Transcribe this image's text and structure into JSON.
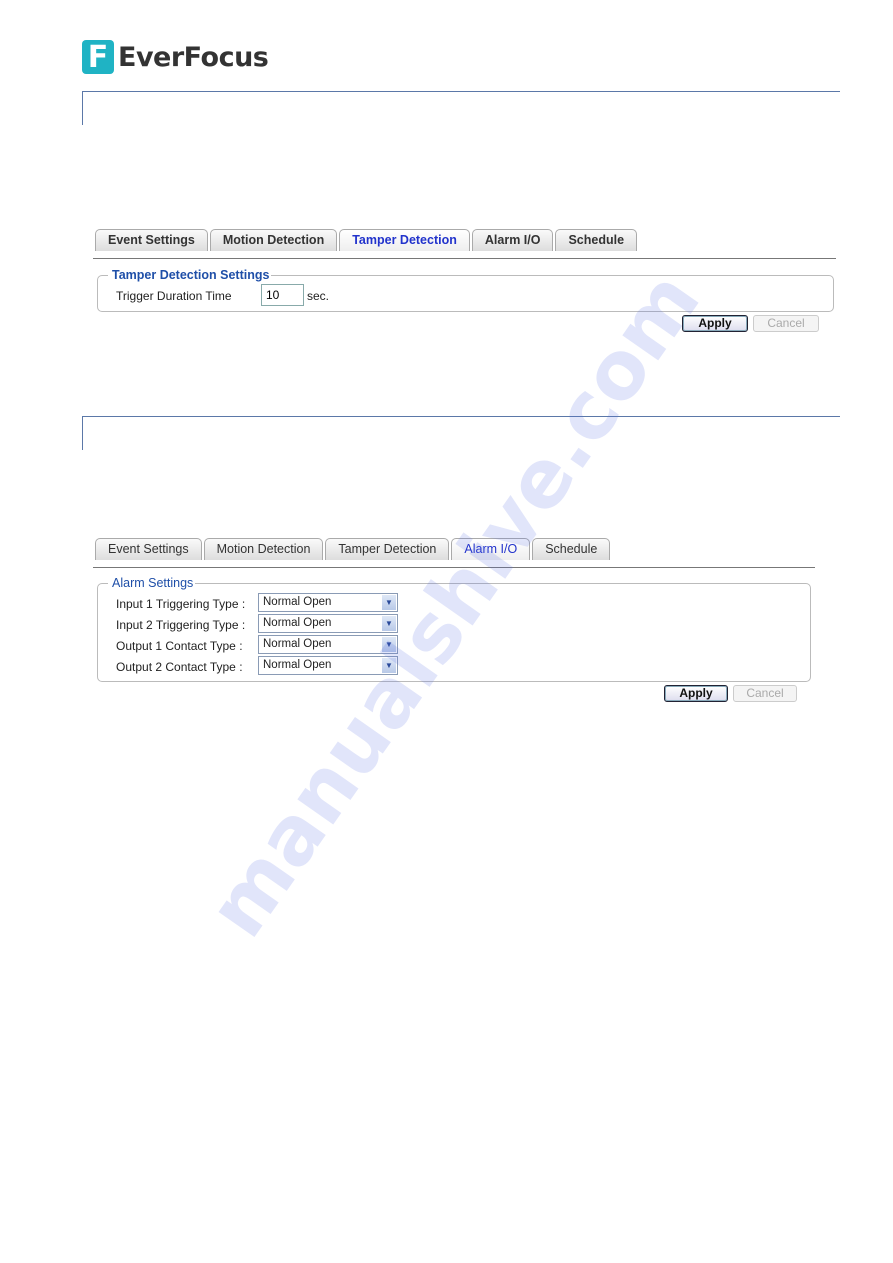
{
  "brand": {
    "name": "EverFocus",
    "mark": "F"
  },
  "watermark": "manualshive.com",
  "tamper_panel": {
    "tabs": [
      {
        "label": "Event Settings"
      },
      {
        "label": "Motion Detection"
      },
      {
        "label": "Tamper Detection",
        "active": true
      },
      {
        "label": "Alarm I/O"
      },
      {
        "label": "Schedule"
      }
    ],
    "legend": "Tamper Detection Settings",
    "trigger_label": "Trigger Duration Time",
    "trigger_value": "10",
    "trigger_unit": "sec.",
    "apply_label": "Apply",
    "cancel_label": "Cancel"
  },
  "alarm_panel": {
    "tabs": [
      {
        "label": "Event Settings"
      },
      {
        "label": "Motion Detection"
      },
      {
        "label": "Tamper Detection"
      },
      {
        "label": "Alarm I/O",
        "active": true
      },
      {
        "label": "Schedule"
      }
    ],
    "legend": "Alarm Settings",
    "rows": [
      {
        "label": "Input 1 Triggering Type :",
        "value": "Normal Open"
      },
      {
        "label": "Input 2 Triggering Type :",
        "value": "Normal Open"
      },
      {
        "label": "Output 1 Contact Type :",
        "value": "Normal Open"
      },
      {
        "label": "Output 2 Contact Type :",
        "value": "Normal Open"
      }
    ],
    "apply_label": "Apply",
    "cancel_label": "Cancel"
  },
  "colors": {
    "brand": "#1fb3c4",
    "active_tab": "#2233cc",
    "legend": "#1f4fa8"
  }
}
